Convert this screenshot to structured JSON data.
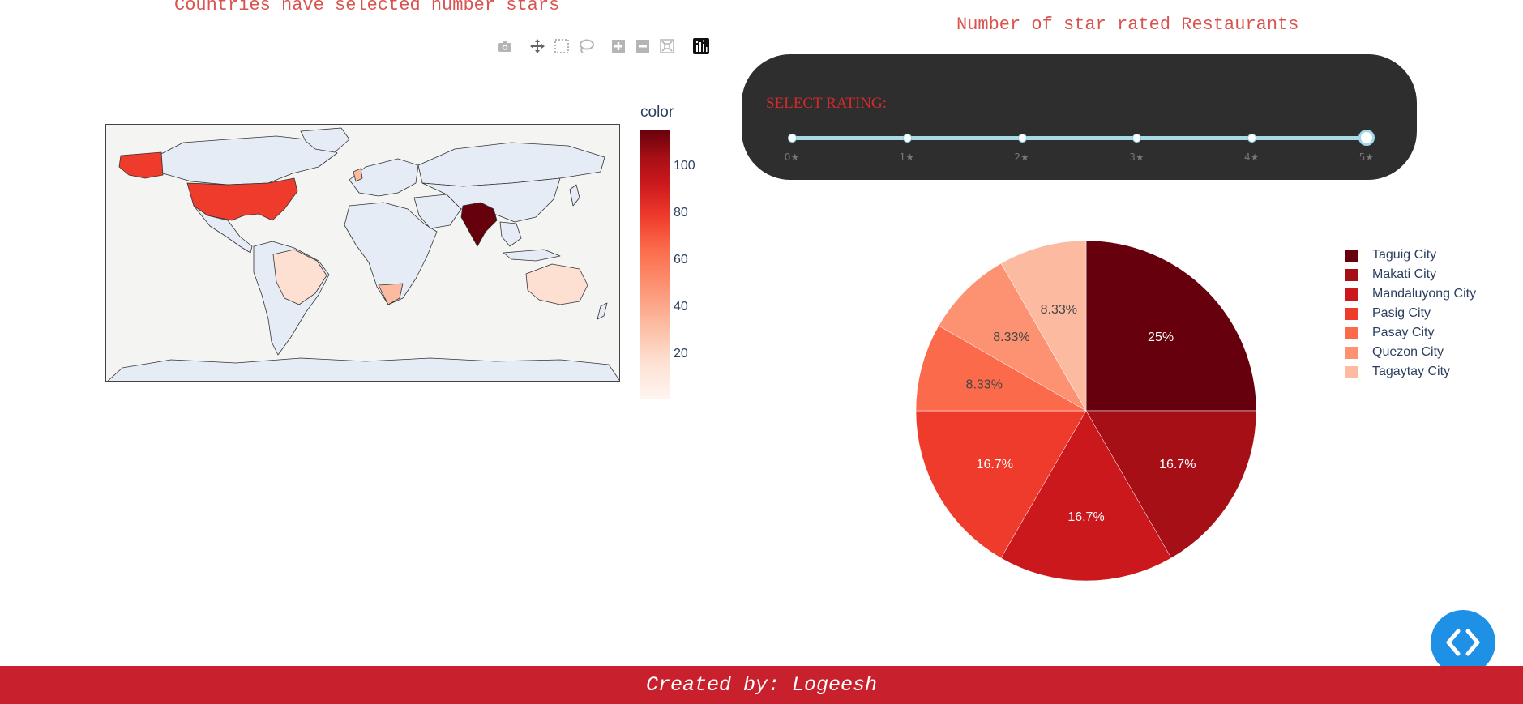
{
  "map": {
    "title": "Countries have selected number stars",
    "colorbar": {
      "title": "color",
      "ticks": [
        "100",
        "80",
        "60",
        "40",
        "20"
      ],
      "colorscale": [
        "#fff5f0",
        "#fee0d2",
        "#fcbba1",
        "#fc9272",
        "#fb6a4a",
        "#ef3b2c",
        "#cb181d",
        "#a50f15",
        "#67000d"
      ]
    },
    "land_color": "#e5ecf6",
    "ocean_color": "#f4f4f2"
  },
  "modebar": {
    "icons": [
      "camera-icon",
      "pan-icon",
      "box-select-icon",
      "lasso-icon",
      "zoom-in-icon",
      "zoom-out-icon",
      "reset-icon",
      "plotly-logo-icon"
    ]
  },
  "slider": {
    "label": "SELECT RATING:",
    "marks": [
      "0★",
      "1★",
      "2★",
      "3★",
      "4★",
      "5★"
    ],
    "value": 5,
    "min": 0,
    "max": 5
  },
  "pie": {
    "title": "Number of star rated Restaurants"
  },
  "chart_data": {
    "type": "pie",
    "title": "Number of star rated Restaurants",
    "labels": [
      "Taguig City",
      "Makati City",
      "Mandaluyong City",
      "Pasig City",
      "Pasay City",
      "Quezon City",
      "Tagaytay City"
    ],
    "values": [
      3,
      2,
      2,
      2,
      1,
      1,
      1
    ],
    "percent_labels": [
      "25%",
      "16.7%",
      "16.7%",
      "16.7%",
      "8.33%",
      "8.33%",
      "8.33%"
    ],
    "colors": [
      "#67000d",
      "#a50f15",
      "#cb181d",
      "#ef3b2c",
      "#fb6a4a",
      "#fc9272",
      "#fcbba1"
    ],
    "legend_position": "right"
  },
  "footer": {
    "text": "Created by: Logeesh"
  },
  "code_button": {
    "icon": "code-icon"
  }
}
